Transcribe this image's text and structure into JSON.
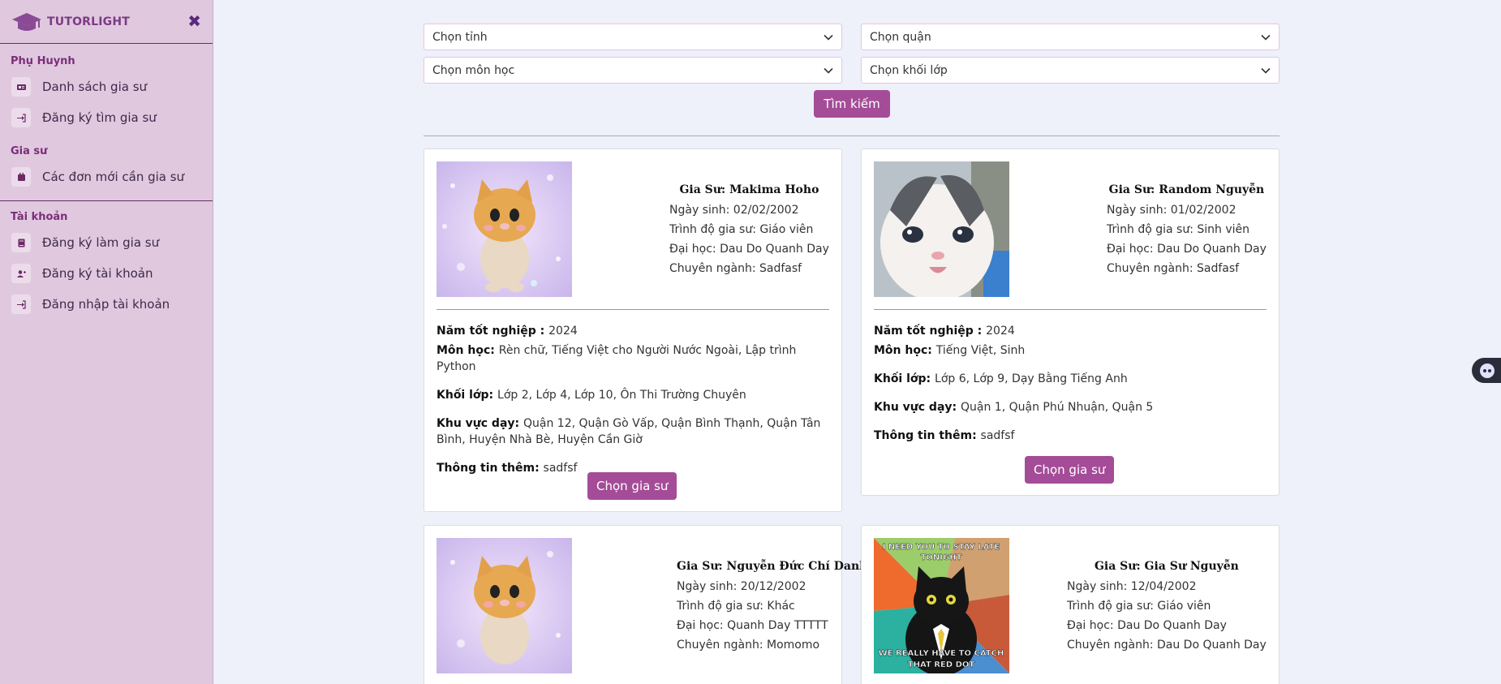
{
  "brand": {
    "name": "TUTORLIGHT"
  },
  "sidebar": {
    "sections": [
      {
        "title": "Phụ Huynh",
        "items": [
          "Danh sách gia sư",
          "Đăng ký tìm gia sư"
        ]
      },
      {
        "title": "Gia sư",
        "items": [
          "Các đơn mới cần gia sư"
        ]
      },
      {
        "title": "Tài khoản",
        "items": [
          "Đăng ký làm gia sư",
          "Đăng ký tài khoản",
          "Đăng nhập tài khoản"
        ]
      }
    ]
  },
  "filters": {
    "province": "Chọn tỉnh",
    "district": "Chọn quận",
    "subject": "Chọn môn học",
    "grade": "Chọn khối lớp",
    "search_label": "Tìm kiếm"
  },
  "field_labels": {
    "dob": "Ngày sinh: ",
    "level": "Trình độ gia sư: ",
    "university": "Đại học: ",
    "major": "Chuyên ngành: ",
    "grad_year": "Năm tốt nghiệp : ",
    "subjects": "Môn học: ",
    "grades": "Khối lớp: ",
    "areas": "Khu vực dạy: ",
    "extra": "Thông tin thêm: "
  },
  "choose_label": "Chọn gia sư",
  "tutors": [
    {
      "name": "Gia Sư: Makima Hoho",
      "dob": "02/02/2002",
      "level": "Giáo viên",
      "university": "Dau Do Quanh Day",
      "major": "Sadfasf",
      "grad_year": "2024",
      "subjects": "Rèn chữ, Tiếng Việt cho Người Nước Ngoài, Lập trình Python",
      "grades": "Lớp 2, Lớp 4, Lớp 10, Ôn Thi Trường Chuyên",
      "areas": "Quận 12, Quận Gò Vấp, Quận Bình Thạnh, Quận Tân Bình, Huyện Nhà Bè, Huyện Cần Giờ",
      "extra": "sadfsf"
    },
    {
      "name": "Gia Sư: Random Nguyễn",
      "dob": "01/02/2002",
      "level": "Sinh viên",
      "university": "Dau Do Quanh Day",
      "major": "Sadfasf",
      "grad_year": "2024",
      "subjects": "Tiếng Việt, Sinh",
      "grades": "Lớp 6, Lớp 9, Dạy Bằng Tiếng Anh",
      "areas": "Quận 1, Quận Phú Nhuận, Quận 5",
      "extra": "sadfsf"
    },
    {
      "name": "Gia Sư: Nguyễn Đức Chí Danh",
      "dob": "20/12/2002",
      "level": "Khác",
      "university": "Quanh Day TTTTT",
      "major": "Momomo"
    },
    {
      "name": "Gia Sư: Gia Sư Nguyễn",
      "dob": "12/04/2002",
      "level": "Giáo viên",
      "university": "Dau Do Quanh Day",
      "major": "Dau Do Quanh Day",
      "meme_top": "I NEED YOU TO STAY LATE TONIGHT",
      "meme_bottom": "WE REALLY HAVE TO CATCH THAT RED DOT"
    }
  ],
  "colors": {
    "accent": "#a44c98",
    "sidebar_bg": "#e0c9df",
    "page_bg": "#eef0fa"
  }
}
